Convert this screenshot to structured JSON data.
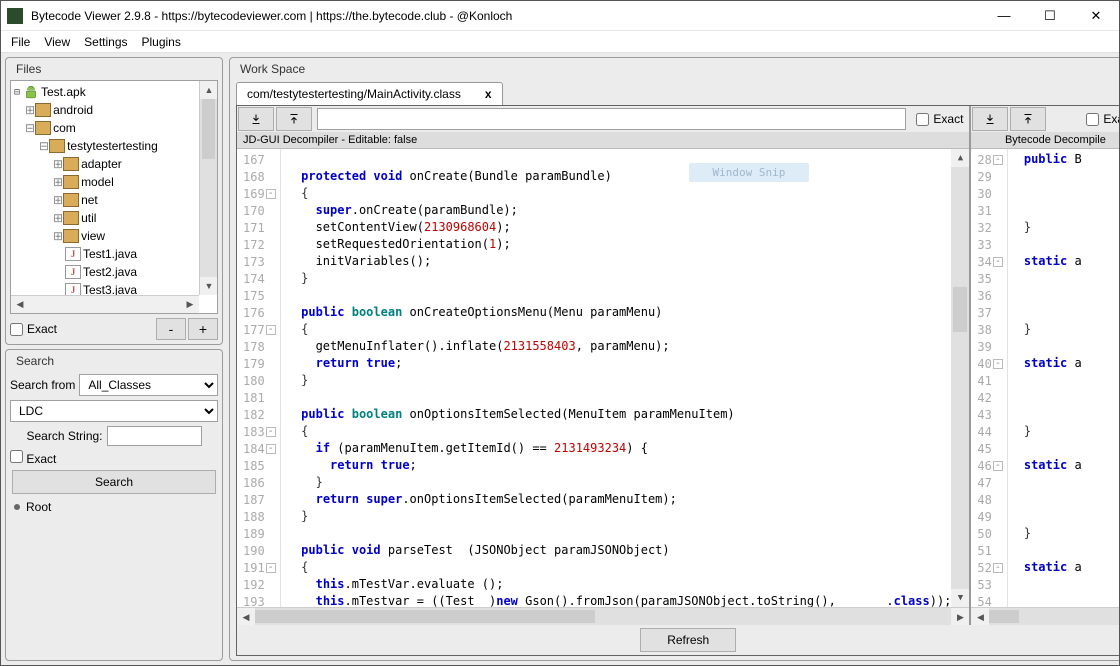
{
  "window": {
    "title": "Bytecode Viewer 2.9.8 - https://bytecodeviewer.com | https://the.bytecode.club - @Konloch"
  },
  "menu": [
    "File",
    "View",
    "Settings",
    "Plugins"
  ],
  "filesPanel": {
    "title": "Files",
    "exactLabel": "Exact",
    "minus": "-",
    "plus": "+",
    "tree": {
      "root": "Test.apk",
      "android": "android",
      "com": "com",
      "testy": "testytestertesting",
      "sub": [
        "adapter",
        "model",
        "net",
        "util",
        "view"
      ],
      "java": [
        "Test1.java",
        "Test2.java",
        "Test3.java"
      ]
    }
  },
  "searchPanel": {
    "title": "Search",
    "searchFrom": "Search from",
    "searchFromValue": "All_Classes",
    "mode": "LDC",
    "searchString": "Search String:",
    "exact": "Exact",
    "btn": "Search",
    "root": "Root"
  },
  "workspace": {
    "title": "Work Space",
    "tab": "com/testytestertesting/MainActivity.class",
    "exact": "Exact",
    "refresh": "Refresh",
    "decTitle": "JD-GUI Decompiler - Editable: false",
    "byteTitle": "Bytecode Decompile",
    "snip": "Window Snip"
  },
  "code": {
    "lines": [
      {
        "n": 167,
        "t": ""
      },
      {
        "n": 168,
        "t": "  <span class='kw'>protected</span> <span class='kw'>void</span> onCreate(Bundle paramBundle)"
      },
      {
        "n": 169,
        "f": 1,
        "t": "  <span class='brace'>{</span>"
      },
      {
        "n": 170,
        "t": "    <span class='kw'>super</span>.onCreate(paramBundle);"
      },
      {
        "n": 171,
        "t": "    setContentView(<span class='num'>2130968604</span>);"
      },
      {
        "n": 172,
        "t": "    setRequestedOrientation(<span class='num'>1</span>);"
      },
      {
        "n": 173,
        "t": "    initVariables();"
      },
      {
        "n": 174,
        "t": "  <span class='brace'>}</span>"
      },
      {
        "n": 175,
        "t": ""
      },
      {
        "n": 176,
        "t": "  <span class='kw'>public</span> <span class='typ'>boolean</span> onCreateOptionsMenu(Menu paramMenu)"
      },
      {
        "n": 177,
        "f": 1,
        "t": "  <span class='brace'>{</span>"
      },
      {
        "n": 178,
        "t": "    getMenuInflater().inflate(<span class='num'>2131558403</span>, paramMenu);"
      },
      {
        "n": 179,
        "t": "    <span class='kw'>return</span> <span class='kw'>true</span>;"
      },
      {
        "n": 180,
        "t": "  <span class='brace'>}</span>"
      },
      {
        "n": 181,
        "t": ""
      },
      {
        "n": 182,
        "t": "  <span class='kw'>public</span> <span class='typ'>boolean</span> onOptionsItemSelected(MenuItem paramMenuItem)"
      },
      {
        "n": 183,
        "f": 1,
        "t": "  <span class='brace'>{</span>"
      },
      {
        "n": 184,
        "f": 1,
        "t": "    <span class='kw'>if</span> (paramMenuItem.getItemId() == <span class='num'>2131493234</span>) {"
      },
      {
        "n": 185,
        "t": "      <span class='kw'>return</span> <span class='kw'>true</span>;"
      },
      {
        "n": 186,
        "t": "    <span class='brace'>}</span>"
      },
      {
        "n": 187,
        "t": "    <span class='kw'>return</span> <span class='kw'>super</span>.onOptionsItemSelected(paramMenuItem);"
      },
      {
        "n": 188,
        "t": "  <span class='brace'>}</span>"
      },
      {
        "n": 189,
        "t": ""
      },
      {
        "n": 190,
        "t": "  <span class='kw'>public</span> <span class='kw'>void</span> parseTest  (JSONObject paramJSONObject)"
      },
      {
        "n": 191,
        "f": 1,
        "t": "  <span class='brace'>{</span>"
      },
      {
        "n": 192,
        "t": "    <span class='kw'>this</span>.mTestVar.evaluate ();"
      },
      {
        "n": 193,
        "t": "    <span class='kw'>this</span>.mTestvar = ((Test  )<span class='kw'>new</span> Gson().fromJson(paramJSONObject.toString(),       .<span class='kw'>class</span>));"
      }
    ]
  },
  "byteCode": {
    "lines": [
      {
        "n": 28,
        "f": 1,
        "t": "<span class='kw'>public</span> B"
      },
      {
        "n": 29,
        "t": ""
      },
      {
        "n": 30,
        "t": ""
      },
      {
        "n": 31,
        "t": ""
      },
      {
        "n": 32,
        "t": "<span class='brace'>}</span>"
      },
      {
        "n": 33,
        "t": ""
      },
      {
        "n": 34,
        "f": 1,
        "t": "<span class='kw'>static</span> a"
      },
      {
        "n": 35,
        "t": ""
      },
      {
        "n": 36,
        "t": ""
      },
      {
        "n": 37,
        "t": ""
      },
      {
        "n": 38,
        "t": "<span class='brace'>}</span>"
      },
      {
        "n": 39,
        "t": ""
      },
      {
        "n": 40,
        "f": 1,
        "t": "<span class='kw'>static</span> a"
      },
      {
        "n": 41,
        "t": ""
      },
      {
        "n": 42,
        "t": ""
      },
      {
        "n": 43,
        "t": ""
      },
      {
        "n": 44,
        "t": "<span class='brace'>}</span>"
      },
      {
        "n": 45,
        "t": ""
      },
      {
        "n": 46,
        "f": 1,
        "t": "<span class='kw'>static</span> a"
      },
      {
        "n": 47,
        "t": ""
      },
      {
        "n": 48,
        "t": ""
      },
      {
        "n": 49,
        "t": ""
      },
      {
        "n": 50,
        "t": "<span class='brace'>}</span>"
      },
      {
        "n": 51,
        "t": ""
      },
      {
        "n": 52,
        "f": 1,
        "t": "<span class='kw'>static</span> a"
      },
      {
        "n": 53,
        "t": ""
      },
      {
        "n": 54,
        "t": ""
      }
    ]
  }
}
